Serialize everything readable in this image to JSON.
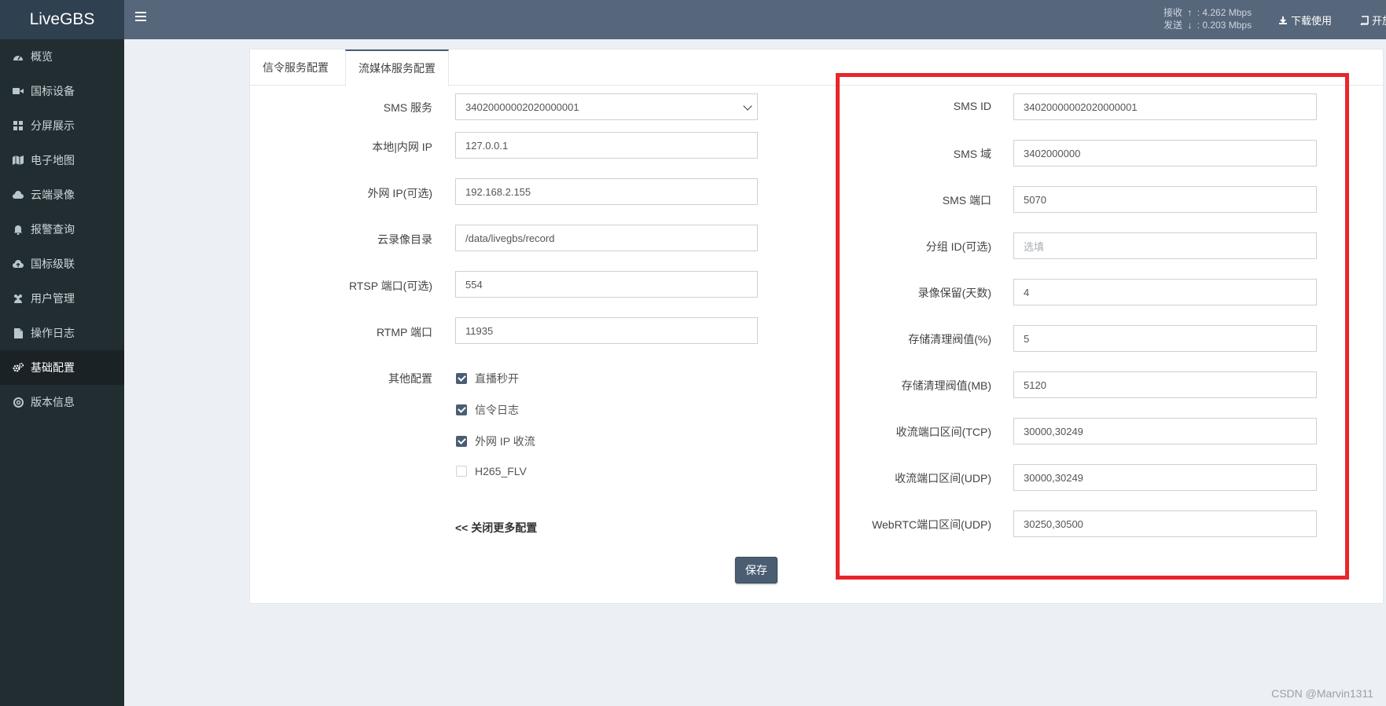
{
  "app": {
    "title": "LiveGBS"
  },
  "header": {
    "net_recv_label": "接收",
    "net_recv_value": "4.262 Mbps",
    "net_send_label": "发送",
    "net_send_value": "0.203 Mbps",
    "download_label": "下载使用",
    "open_label": "开放"
  },
  "sidebar": {
    "items": [
      {
        "label": "概览",
        "icon": "dashboard-icon"
      },
      {
        "label": "国标设备",
        "icon": "video-camera-icon"
      },
      {
        "label": "分屏展示",
        "icon": "grid-icon"
      },
      {
        "label": "电子地图",
        "icon": "map-icon"
      },
      {
        "label": "云端录像",
        "icon": "cloud-icon"
      },
      {
        "label": "报警查询",
        "icon": "bell-icon"
      },
      {
        "label": "国标级联",
        "icon": "cloud-upload-icon"
      },
      {
        "label": "用户管理",
        "icon": "users-icon"
      },
      {
        "label": "操作日志",
        "icon": "file-icon"
      },
      {
        "label": "基础配置",
        "icon": "gears-icon"
      },
      {
        "label": "版本信息",
        "icon": "lifebuoy-icon"
      }
    ],
    "active_index": 9
  },
  "tabs": [
    {
      "label": "信令服务配置"
    },
    {
      "label": "流媒体服务配置"
    }
  ],
  "left_form": {
    "sms_service": {
      "label": "SMS 服务",
      "value": "34020000002020000001"
    },
    "local_ip": {
      "label": "本地|内网 IP",
      "value": "127.0.0.1"
    },
    "public_ip": {
      "label": "外网 IP(可选)",
      "value": "192.168.2.155"
    },
    "record_dir": {
      "label": "云录像目录",
      "value": "/data/livegbs/record"
    },
    "rtsp_port": {
      "label": "RTSP 端口(可选)",
      "value": "554"
    },
    "rtmp_port": {
      "label": "RTMP 端口",
      "value": "11935"
    },
    "other_label": "其他配置",
    "options": [
      {
        "label": "直播秒开",
        "checked": true
      },
      {
        "label": "信令日志",
        "checked": true
      },
      {
        "label": "外网 IP 收流",
        "checked": true
      },
      {
        "label": "H265_FLV",
        "checked": false
      }
    ],
    "collapse_link": "<< 关闭更多配置",
    "save_label": "保存"
  },
  "right_form": {
    "fields": [
      {
        "label": "SMS ID",
        "value": "34020000002020000001",
        "placeholder": ""
      },
      {
        "label": "SMS 域",
        "value": "3402000000",
        "placeholder": ""
      },
      {
        "label": "SMS 端口",
        "value": "5070",
        "placeholder": ""
      },
      {
        "label": "分组 ID(可选)",
        "value": "",
        "placeholder": "选填"
      },
      {
        "label": "录像保留(天数)",
        "value": "4",
        "placeholder": ""
      },
      {
        "label": "存储清理阀值(%)",
        "value": "5",
        "placeholder": ""
      },
      {
        "label": "存储清理阀值(MB)",
        "value": "5120",
        "placeholder": ""
      },
      {
        "label": "收流端口区间(TCP)",
        "value": "30000,30249",
        "placeholder": ""
      },
      {
        "label": "收流端口区间(UDP)",
        "value": "30000,30249",
        "placeholder": ""
      },
      {
        "label": "WebRTC端口区间(UDP)",
        "value": "30250,30500",
        "placeholder": ""
      }
    ]
  },
  "watermark": "CSDN @Marvin1311",
  "colors": {
    "highlight_border": "#e8262c",
    "accent": "#4a5d72"
  }
}
